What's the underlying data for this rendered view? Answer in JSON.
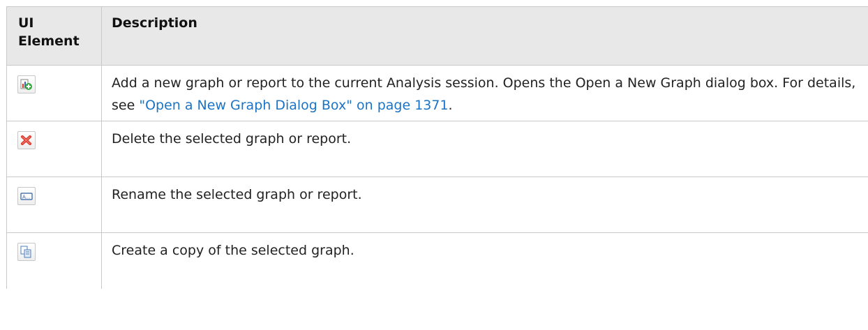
{
  "table": {
    "headers": {
      "ui_element": "UI Element",
      "description": "Description"
    },
    "rows": [
      {
        "icon": "add-graph-icon",
        "text_before": "Add a new graph or report to the current Analysis session. Opens the Open a New Graph dialog box. For details, see ",
        "link": "\"Open a New Graph Dialog Box\" on page 1371",
        "text_after": "."
      },
      {
        "icon": "delete-icon",
        "text": "Delete the selected graph or report."
      },
      {
        "icon": "rename-icon",
        "text": "Rename the selected graph or report."
      },
      {
        "icon": "copy-graph-icon",
        "text": "Create a copy of the selected graph."
      }
    ]
  },
  "colors": {
    "header_background": "#e8e8e8",
    "border": "#c9c9c9",
    "link": "#1b73c6",
    "delete_icon": "#d9382b",
    "add_icon": "#3aa845"
  }
}
